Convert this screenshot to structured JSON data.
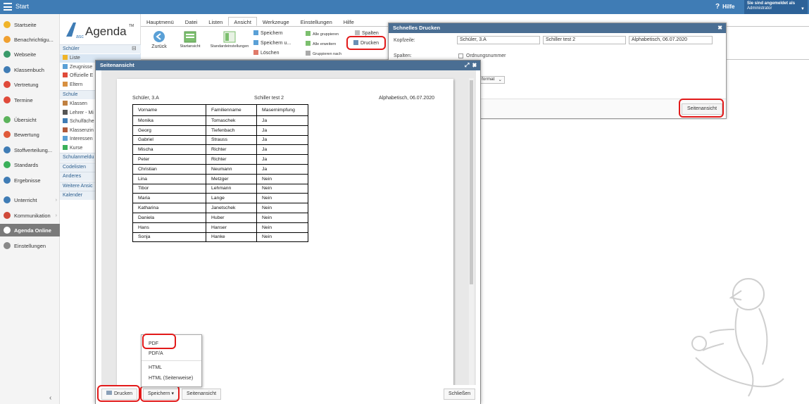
{
  "topbar": {
    "title": "Start",
    "help": "Hilfe",
    "user_line1": "Sie sind angemeldet als",
    "user_line2": "Administrator"
  },
  "sidebar": {
    "items": [
      {
        "label": "Startseite",
        "color": "#f0b429"
      },
      {
        "label": "Benachrichtigu...",
        "color": "#f0a030"
      },
      {
        "label": "Webseite",
        "color": "#3a9a6a"
      },
      {
        "label": "Klassenbuch",
        "color": "#3f7cb5"
      },
      {
        "label": "Vertretung",
        "color": "#e04a3a"
      },
      {
        "label": "Termine",
        "color": "#e04a3a"
      },
      {
        "label": "Übersicht",
        "color": "#5bb35b"
      },
      {
        "label": "Bewertung",
        "color": "#e05a3a"
      },
      {
        "label": "Stoffverteilung...",
        "color": "#3f7cb5"
      },
      {
        "label": "Standards",
        "color": "#3ab05a"
      },
      {
        "label": "Ergebnisse",
        "color": "#3f7cb5"
      },
      {
        "label": "Unterricht",
        "color": "#3f7cb5"
      },
      {
        "label": "Kommunikation",
        "color": "#d04a3a"
      },
      {
        "label": "Agenda Online",
        "color": "#ffffff"
      },
      {
        "label": "Einstellungen",
        "color": "#888888"
      }
    ]
  },
  "col2": {
    "logo": "ascAgenda",
    "groups": [
      {
        "label": "Schüler",
        "items": [
          "Liste",
          "Zeugnisse",
          "Offizielle E",
          "Eltern"
        ]
      },
      {
        "label": "Schule",
        "items": [
          "Klassen",
          "Lehrer - Mi",
          "Schulfäche",
          "Klassenzin",
          "Interessen",
          "Kurse"
        ]
      },
      {
        "label": "Schulanmeldu",
        "items": []
      },
      {
        "label": "Codelisten",
        "items": []
      },
      {
        "label": "Anderes",
        "items": []
      },
      {
        "label": "Weitere Ansic",
        "items": []
      },
      {
        "label": "Kalender",
        "items": []
      }
    ]
  },
  "ribbon": {
    "tabs": [
      "Hauptmenü",
      "Datei",
      "Listen",
      "Ansicht",
      "Werkzeuge",
      "Einstellungen",
      "Hilfe"
    ],
    "active_tab": "Ansicht",
    "back": "Zurück",
    "startansicht": "Startansicht",
    "standard": "Standardeinstellungen",
    "save": "Speichern",
    "save_as": "Speichern u...",
    "delete": "Löschen",
    "group_all": "Alle gruppieren",
    "expand_all": "Alle erweitern",
    "group_by": "Gruppieren nach",
    "columns": "Spalten",
    "print": "Drucken"
  },
  "quick_print": {
    "title": "Schnelles Drucken",
    "header_label": "Kopfzeile:",
    "header_values": [
      "Schüler, 3.A",
      "Schiller test 2",
      "Alphabetisch, 06.07.2020"
    ],
    "columns_label": "Spalten:",
    "ordinal_label": "Ordnungsnummer",
    "format_value": "format",
    "preview_button": "Seitenansicht"
  },
  "preview": {
    "title": "Seitenansicht",
    "page_header": [
      "Schüler, 3.A",
      "Schiller test 2",
      "Alphabetisch, 06.07.2020"
    ],
    "columns": [
      "Vorname",
      "Familienname",
      "Masernimpfung"
    ],
    "rows": [
      [
        "Monika",
        "Tomaschek",
        "Ja"
      ],
      [
        "Georg",
        "Tiefenbach",
        "Ja"
      ],
      [
        "Gabriel",
        "Strauss",
        "Ja"
      ],
      [
        "Mischa",
        "Richter",
        "Ja"
      ],
      [
        "Peter",
        "Richter",
        "Ja"
      ],
      [
        "Christian",
        "Neumann",
        "Ja"
      ],
      [
        "Lina",
        "Metzger",
        "Nein"
      ],
      [
        "Tibor",
        "Lehmann",
        "Nein"
      ],
      [
        "Maria",
        "Lange",
        "Nein"
      ],
      [
        "Katharina",
        "Janetschek",
        "Nein"
      ],
      [
        "Daniela",
        "Huber",
        "Nein"
      ],
      [
        "Hans",
        "Hanser",
        "Nein"
      ],
      [
        "Sonja",
        "Hanke",
        "Nein"
      ]
    ],
    "buttons": {
      "print": "Drucken",
      "save": "Speichern ▾",
      "preview": "Seitenansicht",
      "close": "Schließen"
    },
    "save_menu": [
      "PDF",
      "PDF/A",
      "HTML",
      "HTML (Seitenweise)"
    ]
  }
}
